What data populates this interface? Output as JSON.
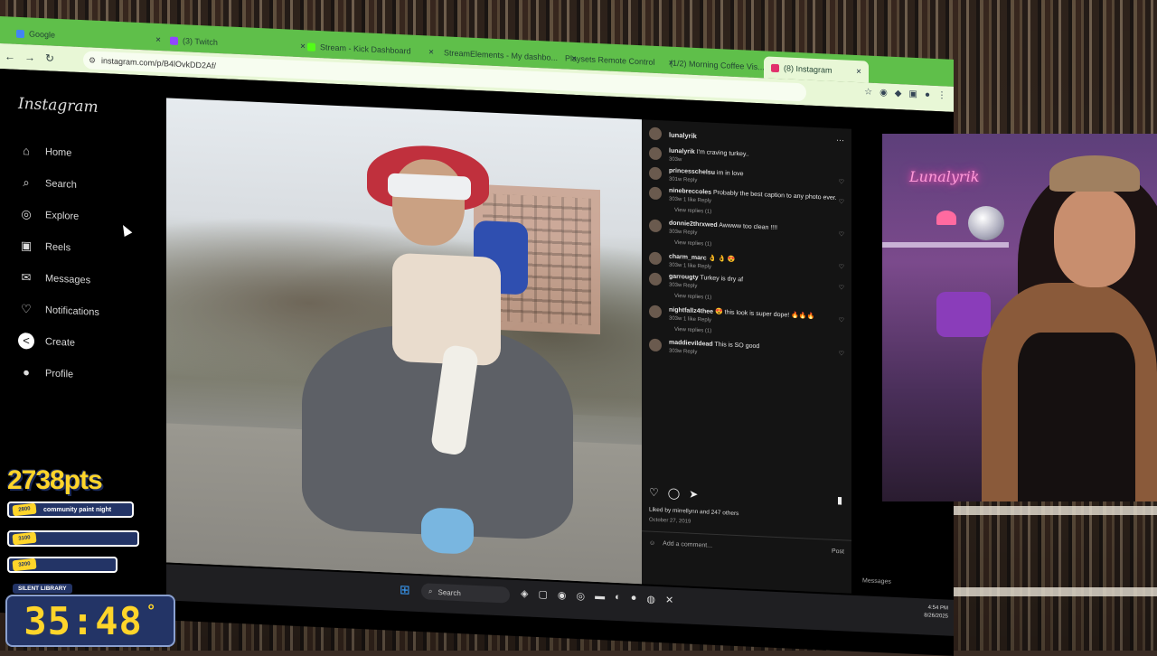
{
  "browser": {
    "tabs": [
      {
        "label": "Google",
        "color": "#4285f4",
        "active": false
      },
      {
        "label": "(3) Twitch",
        "color": "#9146ff",
        "active": false
      },
      {
        "label": "Stream - Kick Dashboard",
        "color": "#53fc18",
        "active": false
      },
      {
        "label": "StreamElements - My dashbo...",
        "color": "#3b5cff",
        "active": false
      },
      {
        "label": "Playsets Remote Control",
        "color": "#e06",
        "active": false
      },
      {
        "label": "(1/2) Morning Coffee Vis...",
        "color": "#ff0000",
        "active": false
      },
      {
        "label": "(8) Instagram",
        "color": "#e1306c",
        "active": true
      }
    ],
    "url": "instagram.com/p/B4lOvkDD2Af/"
  },
  "instagram": {
    "logo": "Instagram",
    "nav": [
      {
        "label": "Home",
        "icon": "home-icon",
        "glyph": "⌂"
      },
      {
        "label": "Search",
        "icon": "search-icon",
        "glyph": "⌕"
      },
      {
        "label": "Explore",
        "icon": "compass-icon",
        "glyph": "◎"
      },
      {
        "label": "Reels",
        "icon": "reels-icon",
        "glyph": "▣"
      },
      {
        "label": "Messages",
        "icon": "messenger-icon",
        "glyph": "✉"
      },
      {
        "label": "Notifications",
        "icon": "heart-icon",
        "glyph": "♡"
      },
      {
        "label": "Create",
        "icon": "create-icon",
        "glyph": "<"
      },
      {
        "label": "Profile",
        "icon": "profile-icon",
        "glyph": "●"
      }
    ]
  },
  "post": {
    "author": "lunalyrik",
    "comments": [
      {
        "user": "lunalyrik",
        "text": "I'm craving turkey..",
        "meta": "303w",
        "replies": ""
      },
      {
        "user": "princesschelsu",
        "text": "im in love",
        "meta": "301w   Reply",
        "replies": ""
      },
      {
        "user": "ninebreccoles",
        "text": "Probably the best caption to any photo ever.",
        "meta": "303w   1 like   Reply",
        "replies": "View replies (1)"
      },
      {
        "user": "donnie2thrxwed",
        "text": "Awwww too clean !!!!",
        "meta": "303w   Reply",
        "replies": "View replies (1)"
      },
      {
        "user": "charm_marc",
        "text": "👌 👌 😍",
        "meta": "303w   1 like   Reply",
        "replies": ""
      },
      {
        "user": "garrougty",
        "text": "Turkey is dry af",
        "meta": "303w   Reply",
        "replies": "View replies (1)"
      },
      {
        "user": "nightfallz4thee",
        "text": "😍 this look is super dope! 🔥🔥🔥",
        "meta": "303w   1 like   Reply",
        "replies": "View replies (1)"
      },
      {
        "user": "maddievildead",
        "text": "This is SO good",
        "meta": "303w   Reply",
        "replies": ""
      }
    ],
    "liked_by": "Liked by mirrellynn and 247 others",
    "date": "October 27, 2019",
    "add_comment_placeholder": "Add a comment...",
    "post_label": "Post"
  },
  "taskbar": {
    "search": "Search",
    "time": "4:54 PM",
    "date": "8/26/2025",
    "messages_label": "Messages"
  },
  "webcam": {
    "neon_sign": "Lunalyrik"
  },
  "overlay": {
    "points": "2738pts",
    "goals": [
      {
        "amount": "2800",
        "label": "community paint night"
      },
      {
        "amount": "3100",
        "label": ""
      },
      {
        "amount": "3200",
        "label": ""
      }
    ],
    "timer_label": "SILENT LIBRARY",
    "timer": "35:48",
    "timer_suffix": "°"
  }
}
